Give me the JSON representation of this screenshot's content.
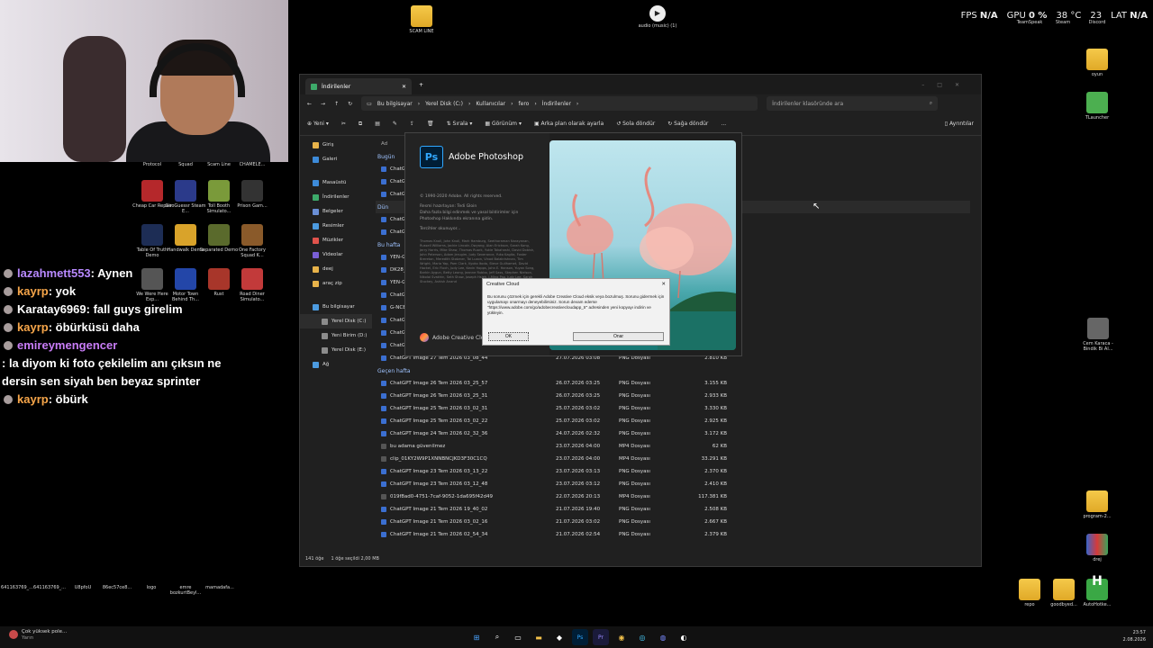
{
  "hud": {
    "fps_label": "FPS",
    "fps_value": "N/A",
    "gpu_label": "GPU",
    "gpu_value": "0 %",
    "temp_value": "38 °C",
    "cpu_value": "23",
    "lat_label": "LAT",
    "lat_value": "N/A"
  },
  "top_desktop_icons": [
    {
      "label": "SCAM LINE"
    },
    {
      "label": "audio (music) (1)"
    },
    {
      "label": "TeamSpeak"
    },
    {
      "label": "Steam"
    },
    {
      "label": "Discord"
    }
  ],
  "left_desktop_icons": [
    {
      "label": "Protocol"
    },
    {
      "label": "Squad"
    },
    {
      "label": "Scam Line"
    },
    {
      "label": "CHAMELE..."
    },
    {
      "label": "Cheap Car Repair"
    },
    {
      "label": "GeoGuessr Steam E..."
    },
    {
      "label": "Toll Booth Simulato..."
    },
    {
      "label": "Prison Gam..."
    },
    {
      "label": "Table Of Truth Demo"
    },
    {
      "label": "Handwalk Demo"
    },
    {
      "label": "Separated Demo"
    },
    {
      "label": "One Factory Squad K..."
    },
    {
      "label": "We Were Here Exp..."
    },
    {
      "label": "Motor Town Behind Th..."
    },
    {
      "label": "Rust"
    },
    {
      "label": "Road Diner Simulato..."
    }
  ],
  "right_desktop_icons": [
    {
      "label": "oyun"
    },
    {
      "label": "TLauncher"
    },
    {
      "label": "Cem Karaca - Bindik Bi Al..."
    },
    {
      "label": "program-2..."
    },
    {
      "label": "drej"
    },
    {
      "label": "repo"
    },
    {
      "label": "goodbyed..."
    },
    {
      "label": "AutoHotke..."
    }
  ],
  "bottom_left_icons": [
    {
      "label": "641163769_..."
    },
    {
      "label": "641163769_..."
    },
    {
      "label": "U8pfoU"
    },
    {
      "label": "86ec57ce8..."
    },
    {
      "label": "logo"
    },
    {
      "label": "emre bozkurtBeyl..."
    },
    {
      "label": "mamadafa..."
    }
  ],
  "chat": [
    {
      "name": "lazahmett553",
      "text": " : Aynen",
      "color": "#b889ff"
    },
    {
      "name": "kayrp",
      "text": " : yok",
      "color": "#f7a64a"
    },
    {
      "name": "Karatay6969",
      "text": " : fall guys girelim",
      "color": "#ffffff"
    },
    {
      "name": "kayrp",
      "text": " : öbürküsü daha",
      "color": "#f7a64a"
    },
    {
      "name": "emireymengencer",
      "text": " : la diyom ki foto çekilelim anı çıksın ne dersin sen siyah ben beyaz sprinter",
      "color": "#c97df7"
    },
    {
      "name": "kayrp",
      "text": " : öbürk",
      "color": "#f7a64a"
    }
  ],
  "explorer": {
    "tab_title": "İndirilenler",
    "breadcrumb": [
      "Bu bilgisayar",
      "Yerel Disk (C:)",
      "Kullanıcılar",
      "fero",
      "İndirilenler"
    ],
    "search_placeholder": "İndirilenler klasöründe ara",
    "toolbar": {
      "new": "Yeni",
      "sort": "Sırala",
      "view": "Görünüm",
      "set_bg": "Arka plan olarak ayarla",
      "rotate_left": "Sola döndür",
      "rotate_right": "Sağa döndür",
      "more": "...",
      "details": "Ayrıntılar"
    },
    "nav": [
      {
        "label": "Giriş",
        "color": "#e8b34a"
      },
      {
        "label": "Galeri",
        "color": "#3d8bd9"
      },
      {
        "label": "Masaüstü",
        "color": "#3d8bd9"
      },
      {
        "label": "İndirilenler",
        "color": "#3daa6a"
      },
      {
        "label": "Belgeler",
        "color": "#6a8fd6"
      },
      {
        "label": "Resimler",
        "color": "#4c9be0"
      },
      {
        "label": "Müzikler",
        "color": "#e0534c"
      },
      {
        "label": "Videolar",
        "color": "#7a5fd6"
      },
      {
        "label": "deej",
        "color": "#e8b34a"
      },
      {
        "label": "araç zip",
        "color": "#e8b34a"
      },
      {
        "label": "Bu bilgisayar",
        "color": "#4c9be0"
      },
      {
        "label": "Yerel Disk (C:)",
        "color": "#8c8c8c"
      },
      {
        "label": "Yeni Birim (D:)",
        "color": "#8c8c8c"
      },
      {
        "label": "Yerel Disk (E:)",
        "color": "#8c8c8c"
      },
      {
        "label": "Ağ",
        "color": "#4c9be0"
      }
    ],
    "column_header": "Ad",
    "group_today": "Bugün",
    "group_yesterday": "Dün",
    "group_this_week": "Bu hafta",
    "group_last_week": "Geçen hafta",
    "top_partial": [
      "ChatG",
      "ChatG",
      "ChatG",
      "ChatG",
      "ChatG",
      "YEN-G",
      "DK28_",
      "YEN-G",
      "ChatG",
      "G-NCE",
      "ChatG",
      "ChatG",
      "ChatG"
    ],
    "rows": [
      {
        "name": "ChatGPT Image 27 Tem 2026 03_08_44",
        "date": "27.07.2026 03:08",
        "type": "PNG Dosyası",
        "size": "2.810 KB"
      },
      {
        "name": "ChatGPT Image 26 Tem 2026 03_25_57",
        "date": "26.07.2026 03:25",
        "type": "PNG Dosyası",
        "size": "3.155 KB"
      },
      {
        "name": "ChatGPT Image 26 Tem 2026 03_25_31",
        "date": "26.07.2026 03:25",
        "type": "PNG Dosyası",
        "size": "2.933 KB"
      },
      {
        "name": "ChatGPT Image 25 Tem 2026 03_02_31",
        "date": "25.07.2026 03:02",
        "type": "PNG Dosyası",
        "size": "3.330 KB"
      },
      {
        "name": "ChatGPT Image 25 Tem 2026 03_02_22",
        "date": "25.07.2026 03:02",
        "type": "PNG Dosyası",
        "size": "2.925 KB"
      },
      {
        "name": "ChatGPT Image 24 Tem 2026 02_32_36",
        "date": "24.07.2026 02:32",
        "type": "PNG Dosyası",
        "size": "3.172 KB"
      },
      {
        "name": "bu adama güvenilmez",
        "date": "23.07.2026 04:00",
        "type": "MP4 Dosyası",
        "size": "62 KB"
      },
      {
        "name": "clip_01KY2W9P1XNNBNCJKD3F30C1CQ",
        "date": "23.07.2026 04:00",
        "type": "MP4 Dosyası",
        "size": "33.291 KB"
      },
      {
        "name": "ChatGPT Image 23 Tem 2026 03_13_22",
        "date": "23.07.2026 03:13",
        "type": "PNG Dosyası",
        "size": "2.370 KB"
      },
      {
        "name": "ChatGPT Image 23 Tem 2026 03_12_48",
        "date": "23.07.2026 03:12",
        "type": "PNG Dosyası",
        "size": "2.410 KB"
      },
      {
        "name": "019f8ad0-4751-7caf-9052-1da695f42d49",
        "date": "22.07.2026 20:13",
        "type": "MP4 Dosyası",
        "size": "117.381 KB"
      },
      {
        "name": "ChatGPT Image 21 Tem 2026 19_40_02",
        "date": "21.07.2026 19:40",
        "type": "PNG Dosyası",
        "size": "2.508 KB"
      },
      {
        "name": "ChatGPT Image 21 Tem 2026 03_02_16",
        "date": "21.07.2026 03:02",
        "type": "PNG Dosyası",
        "size": "2.667 KB"
      },
      {
        "name": "ChatGPT Image 21 Tem 2026 02_54_34",
        "date": "21.07.2026 02:54",
        "type": "PNG Dosyası",
        "size": "2.379 KB"
      }
    ],
    "status_count": "141 öğe",
    "status_selected": "1 öğe seçildi  2,00 MB"
  },
  "photoshop": {
    "logo": "Ps",
    "title": "Adobe Photoshop",
    "copyright": "© 1990-2020 Adobe. All rights reserved.",
    "credit_line": "Resmi hazırlayan: Tedi Gloin",
    "credit_detail": "Daha fazla bilgi edinmek ve yasal bildirimler için Photoshop Hakkında ekranına gidin.",
    "loading": "Tercihler okunuyor...",
    "names": "Thomas Knoll, John Knoll, Mark Hamburg, Seetharaman Narayanan, Russell Williams, Jackie Lincoln-Owyang, Alan Erickson, Sarah Kong, Jerry Harris, Mike Shaw, Thomas Ruark, Yukie Takahashi, David Dobish, John Peterson, Adam Jerugim, Judy Severance, Yuko Kagita, Foster Brereton, Meredith Stotzner, Tai Luxon, Vinod Balakrishnan, Tim Wright, Maria Yap, Pam Clark, Kyoko Itoda, Steve Guilhamet, David Hackel, Eric Floch, Judy Lee, Kevin Hopps, John E. Hanson, Yuyan Song, Barkin Aygun, Betty Leong, Jeanne Rubbo, Jeff Sass, Stephen Nielson, Nikolai Svakhin, Seth Shaw, Joseph Hsieh, I-Ming Pao, Judy Lee, Sarah Stuckey, Ashish Anand",
    "cc_label": "Adobe Creative Cloud"
  },
  "cc_dialog": {
    "title": "Creative Cloud",
    "message": "Bu sorunu çözmek için gerekli Adobe Creative Cloud eksik veya bozulmuş. Sorunu gidermek için uygulamayı onarmayı deneyebilirsiniz. Sorun devam ederse \"https://www.adobe.com/go/adobecreativecloudapp_tr\" adresinden yeni kopyayı indirin ve yükleyin.",
    "ok": "OK",
    "repair": "Onar"
  },
  "taskbar": {
    "weather_line1": "Çok yüksek pole...",
    "weather_line2": "Yarın",
    "time": "23:57",
    "date": "2.08.2026"
  }
}
